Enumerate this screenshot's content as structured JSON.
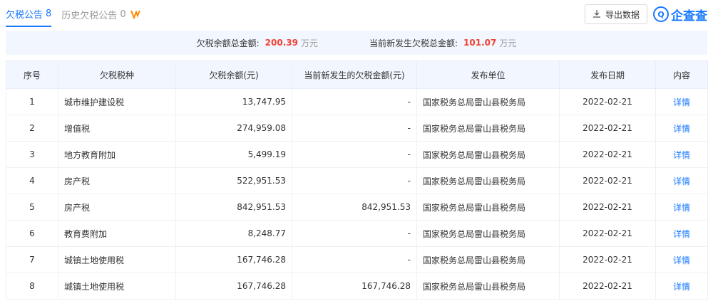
{
  "tabs": [
    {
      "label": "欠税公告",
      "count": "8"
    },
    {
      "label": "历史欠税公告",
      "count": "0"
    }
  ],
  "toolbar": {
    "export_label": "导出数据",
    "brand": "企查查"
  },
  "summary": {
    "total_label": "欠税余额总金额:",
    "total_value": "200.39",
    "total_unit": "万元",
    "new_label": "当前新发生欠税总金额:",
    "new_value": "101.07",
    "new_unit": "万元"
  },
  "table": {
    "headers": [
      "序号",
      "欠税税种",
      "欠税余额(元)",
      "当前新发生的欠税金额(元)",
      "发布单位",
      "发布日期",
      "内容"
    ],
    "rows": [
      [
        "1",
        "城市维护建设税",
        "13,747.95",
        "-",
        "国家税务总局雷山县税务局",
        "2022-02-21",
        "详情"
      ],
      [
        "2",
        "增值税",
        "274,959.08",
        "-",
        "国家税务总局雷山县税务局",
        "2022-02-21",
        "详情"
      ],
      [
        "3",
        "地方教育附加",
        "5,499.19",
        "-",
        "国家税务总局雷山县税务局",
        "2022-02-21",
        "详情"
      ],
      [
        "4",
        "房产税",
        "522,951.53",
        "-",
        "国家税务总局雷山县税务局",
        "2022-02-21",
        "详情"
      ],
      [
        "5",
        "房产税",
        "842,951.53",
        "842,951.53",
        "国家税务总局雷山县税务局",
        "2022-02-21",
        "详情"
      ],
      [
        "6",
        "教育费附加",
        "8,248.77",
        "-",
        "国家税务总局雷山县税务局",
        "2022-02-21",
        "详情"
      ],
      [
        "7",
        "城镇土地使用税",
        "167,746.28",
        "-",
        "国家税务总局雷山县税务局",
        "2022-02-21",
        "详情"
      ],
      [
        "8",
        "城镇土地使用税",
        "167,746.28",
        "167,746.28",
        "国家税务总局雷山县税务局",
        "2022-02-21",
        "详情"
      ]
    ]
  },
  "colors": {
    "accent": "#1677ff",
    "amount": "#f04134",
    "header_bg": "#f2f7ff"
  },
  "icons": {
    "vip": "vip-badge-icon",
    "export": "download-icon",
    "brand": "qichacha-logo-icon"
  }
}
